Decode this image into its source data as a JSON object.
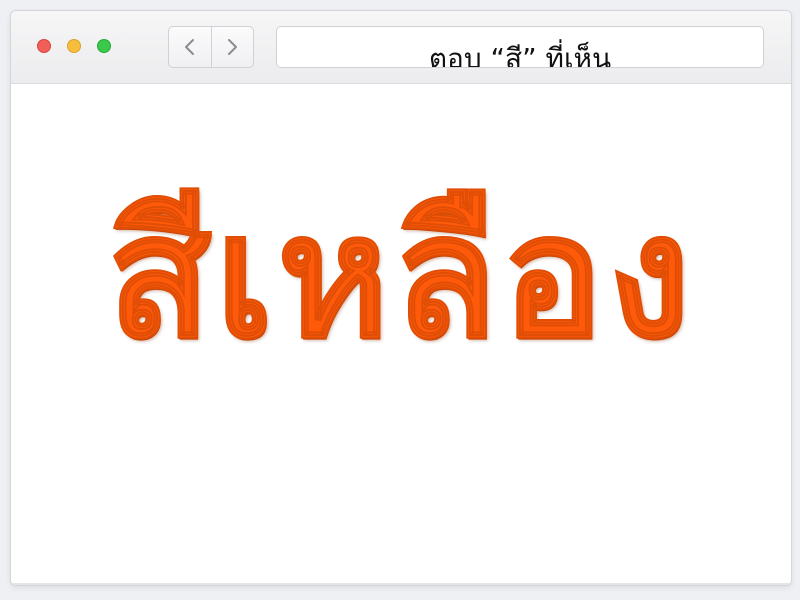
{
  "window": {
    "traffic_lights": {
      "close_color": "#f25f58",
      "minimize_color": "#f7be3b",
      "zoom_color": "#3ac94b"
    },
    "nav": {
      "back_icon": "chevron-left-icon",
      "forward_icon": "chevron-right-icon"
    },
    "address_bar": {
      "text": "ตอบ “สี” ที่เห็น"
    }
  },
  "content": {
    "word": "สีเหลือง",
    "word_color": "#ff5a0a",
    "background_color": "#ffffff"
  }
}
